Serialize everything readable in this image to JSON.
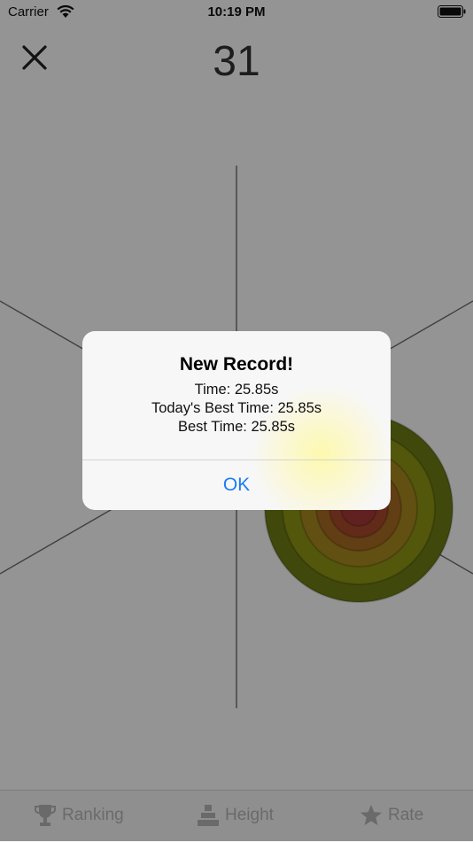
{
  "status_bar": {
    "carrier": "Carrier",
    "time": "10:19 PM"
  },
  "header": {
    "score": "31",
    "close_icon": "close-icon"
  },
  "target": {
    "rings": [
      "#6f7d13",
      "#8f9715",
      "#a98a1f",
      "#a86b22",
      "#a94b2c",
      "#a73a38"
    ]
  },
  "tabs": [
    {
      "label": "Ranking",
      "icon": "trophy-icon"
    },
    {
      "label": "Height",
      "icon": "stack-icon"
    },
    {
      "label": "Rate",
      "icon": "star-icon"
    }
  ],
  "alert": {
    "title": "New Record!",
    "time": "Time: 25.85s",
    "todays_best": "Today's Best Time: 25.85s",
    "best": "Best Time: 25.85s",
    "ok_label": "OK"
  },
  "colors": {
    "accent": "#1b7cf4",
    "overlay": "rgba(0,0,0,0.42)"
  }
}
